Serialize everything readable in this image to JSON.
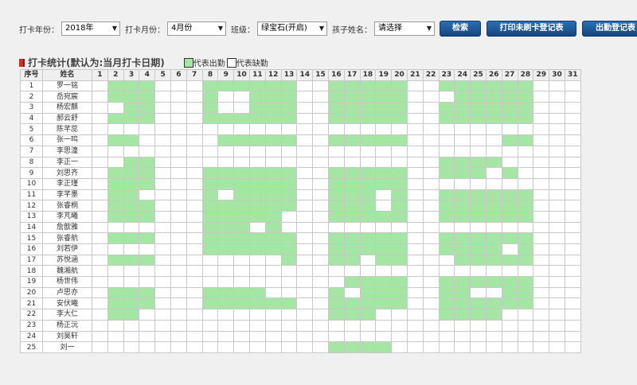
{
  "filters": {
    "year_label": "打卡年份：",
    "year_value": "2018年",
    "month_label": "打卡月份：",
    "month_value": "4月份",
    "class_label": "班级：",
    "class_value": "绿宝石(开启)",
    "child_label": "孩子姓名：",
    "child_value": "请选择"
  },
  "buttons": {
    "search": "检索",
    "print_unswiped": "打印未刷卡登记表",
    "print_attendance": "出勤登记表"
  },
  "section": {
    "title": "打卡统计(默认为:当月打卡日期)",
    "legend_present": "代表出勤",
    "legend_absent": "代表缺勤"
  },
  "colors": {
    "present": "#a5e6a5",
    "absent": "#ffffff",
    "button": "#1d5a99",
    "title_mark": "#c9302c"
  },
  "table": {
    "col_index": "序号",
    "col_name": "姓名",
    "days": [
      "1",
      "2",
      "3",
      "4",
      "5",
      "6",
      "7",
      "8",
      "9",
      "10",
      "11",
      "12",
      "13",
      "14",
      "15",
      "16",
      "17",
      "18",
      "19",
      "20",
      "21",
      "22",
      "23",
      "24",
      "25",
      "26",
      "27",
      "28",
      "29",
      "30",
      "31"
    ],
    "rows": [
      {
        "index": "1",
        "name": "罗一铭",
        "present": [
          2,
          3,
          4,
          8,
          9,
          10,
          11,
          12,
          13,
          16,
          17,
          18,
          19,
          20,
          23,
          24,
          25,
          26,
          27,
          28
        ]
      },
      {
        "index": "2",
        "name": "岳宛宸",
        "present": [
          2,
          3,
          4,
          8,
          11,
          12,
          13,
          16,
          17,
          18,
          19,
          20,
          24,
          25,
          26,
          27,
          28
        ]
      },
      {
        "index": "3",
        "name": "杨宏麒",
        "present": [
          3,
          4,
          8,
          11,
          12,
          13,
          16,
          17,
          18,
          19,
          20,
          23,
          24,
          25,
          26,
          27,
          28
        ]
      },
      {
        "index": "4",
        "name": "郝云舒",
        "present": [
          2,
          3,
          4,
          8,
          9,
          10,
          11,
          12,
          13,
          16,
          17,
          18,
          19,
          20,
          23,
          24,
          25,
          26,
          27,
          28
        ]
      },
      {
        "index": "5",
        "name": "陈芊蕊",
        "present": []
      },
      {
        "index": "6",
        "name": "张一鸣",
        "present": [
          2,
          3,
          9,
          10,
          11,
          12,
          13,
          16,
          17,
          18,
          19,
          20,
          27,
          28
        ]
      },
      {
        "index": "7",
        "name": "李思潼",
        "present": []
      },
      {
        "index": "8",
        "name": "李正一",
        "present": [
          3,
          4,
          23,
          24,
          25,
          26
        ]
      },
      {
        "index": "9",
        "name": "刘思齐",
        "present": [
          2,
          3,
          4,
          8,
          9,
          10,
          11,
          12,
          13,
          16,
          17,
          18,
          19,
          20,
          23,
          24,
          25,
          27
        ]
      },
      {
        "index": "10",
        "name": "李正瑾",
        "present": [
          2,
          3,
          4,
          8,
          9,
          10,
          11,
          12,
          13,
          16,
          17,
          18,
          19,
          20
        ]
      },
      {
        "index": "11",
        "name": "李芊墨",
        "present": [
          2,
          3,
          8,
          10,
          11,
          12,
          13,
          16,
          17,
          18,
          20,
          23,
          24,
          25,
          26,
          27,
          28
        ]
      },
      {
        "index": "12",
        "name": "张睿桐",
        "present": [
          2,
          3,
          4,
          8,
          9,
          10,
          11,
          12,
          13,
          16,
          17,
          18,
          20,
          23,
          24,
          25,
          26,
          27,
          28
        ]
      },
      {
        "index": "13",
        "name": "李芃曦",
        "present": [
          2,
          3,
          4,
          8,
          9,
          10,
          11,
          12,
          16,
          17,
          18,
          19,
          20,
          23,
          24,
          25,
          26,
          27,
          28
        ]
      },
      {
        "index": "14",
        "name": "詹歆雅",
        "present": [
          8,
          9,
          10,
          12
        ]
      },
      {
        "index": "15",
        "name": "张睿航",
        "present": [
          2,
          3,
          4,
          8,
          9,
          10,
          11,
          12,
          13,
          16,
          17,
          18,
          19,
          20,
          23,
          24,
          25,
          26,
          27,
          28
        ]
      },
      {
        "index": "16",
        "name": "刘若伊",
        "present": [
          8,
          9,
          10,
          11,
          12,
          13,
          16,
          17,
          18,
          19,
          20,
          23,
          24,
          25,
          26,
          28
        ]
      },
      {
        "index": "17",
        "name": "苏悦涵",
        "present": [
          2,
          3,
          4,
          13,
          16,
          17,
          19,
          20,
          24,
          25,
          26,
          27,
          28
        ]
      },
      {
        "index": "18",
        "name": "魏湘航",
        "present": []
      },
      {
        "index": "19",
        "name": "杨世伟",
        "present": [
          17,
          18,
          19,
          20,
          23,
          24,
          25,
          26,
          27,
          28
        ]
      },
      {
        "index": "20",
        "name": "卢思亦",
        "present": [
          2,
          3,
          4,
          8,
          9,
          10,
          11,
          16,
          18,
          19,
          20,
          23,
          24,
          27,
          28
        ]
      },
      {
        "index": "21",
        "name": "安伏曦",
        "present": [
          2,
          3,
          4,
          8,
          9,
          10,
          11,
          12,
          13,
          16,
          17,
          18,
          19,
          20,
          23,
          24,
          25,
          26,
          27,
          28
        ]
      },
      {
        "index": "22",
        "name": "李大仁",
        "present": [
          2,
          3,
          16,
          17,
          18,
          23,
          24,
          25,
          26
        ]
      },
      {
        "index": "23",
        "name": "杨正沅",
        "present": []
      },
      {
        "index": "24",
        "name": "刘昊轩",
        "present": []
      },
      {
        "index": "25",
        "name": "刘一",
        "present": [
          16,
          17,
          18,
          19
        ]
      }
    ]
  }
}
